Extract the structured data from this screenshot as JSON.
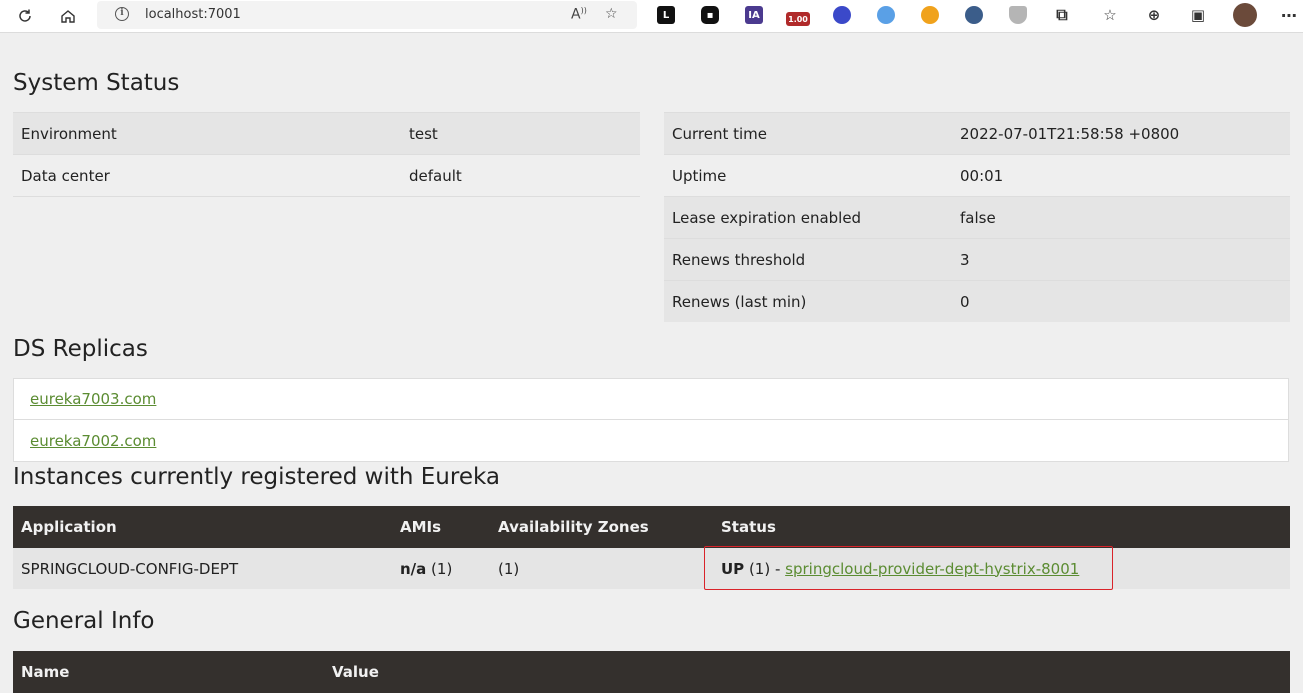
{
  "browser": {
    "url": "localhost:7001",
    "extensions": [
      {
        "name": "lastpass-ext",
        "label": "L",
        "color": "#111111"
      },
      {
        "name": "tab-ext",
        "label": "▪",
        "color": "#111111"
      },
      {
        "name": "ia-ext",
        "label": "IA",
        "color": "#4b3a8f"
      },
      {
        "name": "speed-ext",
        "label": "1.00",
        "color": "#b02a2a"
      },
      {
        "name": "sphere-ext",
        "label": "",
        "color": "#3b49c9"
      },
      {
        "name": "search-ext",
        "label": "",
        "color": "#5aa0e6"
      },
      {
        "name": "shield-colorful-ext",
        "label": "",
        "color": "#f0a21c"
      },
      {
        "name": "cursor-ext",
        "label": "",
        "color": "#3b5d8a"
      },
      {
        "name": "shield-gray-ext",
        "label": "",
        "color": "#9a9a9a"
      }
    ]
  },
  "system_status": {
    "title": "System Status",
    "left": [
      {
        "key": "Environment",
        "value": "test"
      },
      {
        "key": "Data center",
        "value": "default"
      }
    ],
    "right": [
      {
        "key": "Current time",
        "value": "2022-07-01T21:58:58 +0800"
      },
      {
        "key": "Uptime",
        "value": "00:01"
      },
      {
        "key": "Lease expiration enabled",
        "value": "false"
      },
      {
        "key": "Renews threshold",
        "value": "3"
      },
      {
        "key": "Renews (last min)",
        "value": "0"
      }
    ]
  },
  "ds_replicas": {
    "title": "DS Replicas",
    "items": [
      "eureka7003.com",
      "eureka7002.com"
    ]
  },
  "instances": {
    "title": "Instances currently registered with Eureka",
    "headers": [
      "Application",
      "AMIs",
      "Availability Zones",
      "Status"
    ],
    "rows": [
      {
        "application": "SPRINGCLOUD-CONFIG-DEPT",
        "amis_bold": "n/a",
        "amis_count": " (1)",
        "zones": "(1)",
        "status_bold": "UP",
        "status_count": " (1) - ",
        "status_link": "springcloud-provider-dept-hystrix-8001"
      }
    ]
  },
  "general_info": {
    "title": "General Info",
    "headers": [
      "Name",
      "Value"
    ]
  }
}
